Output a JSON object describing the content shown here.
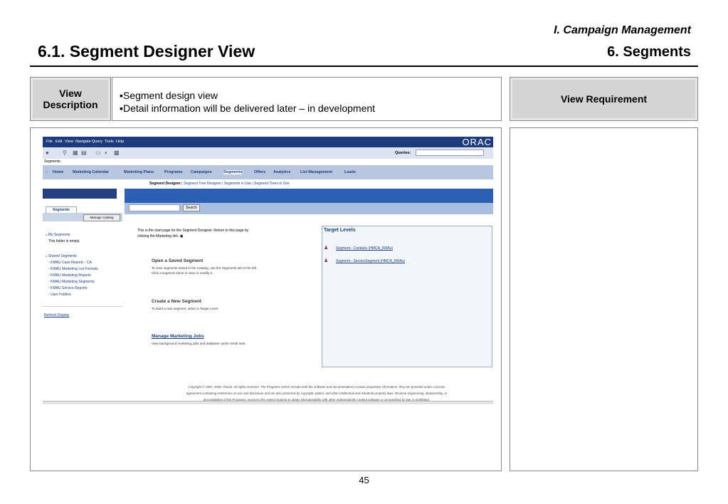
{
  "header": {
    "kicker": "I. Campaign Management",
    "title": "6.1. Segment Designer View",
    "section": "6. Segments"
  },
  "view_description": {
    "label_line1": "View",
    "label_line2": "Description",
    "bullets": [
      "Segment design view",
      "Detail information will be delivered later – in development"
    ]
  },
  "view_requirement": {
    "label": "View Requirement"
  },
  "page_number": "45",
  "screenshot": {
    "menu": [
      "File",
      "Edit",
      "View",
      "Navigate",
      "Query",
      "Tools",
      "Help"
    ],
    "brand": "ORAC",
    "queries_label": "Queries:",
    "crumb": "Segments:",
    "tabs": [
      "Home",
      "Marketing Calendar",
      "Marketing Plans",
      "Programs",
      "Campaigns",
      "Segments",
      "Offers",
      "Analytics",
      "List Management",
      "Leads"
    ],
    "subtabs": {
      "active": "Segment Designer",
      "others": [
        "Segment Tree Designer",
        "Segments in Use",
        "Segment Trees in Use"
      ]
    },
    "left_nav": {
      "tab": "Segments",
      "manage_catalog": "Manage Catalog",
      "my_segments": "My Segments",
      "empty_note": "This folder is empty.",
      "shared_segments": "Shared Segments",
      "shared_items": [
        "KMAU Case Reports - CA",
        "KMAU Marketing List Formats",
        "KMAU Marketing Reports",
        "KMAU Marketing Segments",
        "KMAU Service Reports",
        "User Folders"
      ],
      "refresh": "Refresh Display"
    },
    "search_button": "Search",
    "intro_line1": "This is the start page for the Segment Designer. Return to this page by",
    "intro_line2": "clicking the Marketing link.",
    "open_heading": "Open a Saved Segment",
    "open_desc_1": "To view segments saved in the Catalog, use the Segments tab to the left.",
    "open_desc_2": "Click a segment name to view or modify it.",
    "create_heading": "Create a New Segment",
    "create_desc": "To build a new segment, select a Target Level.",
    "jobs_heading": "Manage Marketing Jobs",
    "jobs_desc": "View background marketing jobs and database cache result sets.",
    "target_levels_title": "Target Levels",
    "target_levels": [
      "Segment - Contacts (HMCA_KMAu)",
      "Segment - ServiceSegment (HMCA_KMAu)"
    ],
    "copyright_1": "Copyright © 1997, 2009, Oracle. All rights reserved. The Programs (which include both the software and documentation) contain proprietary information; they are provided under a license",
    "copyright_2": "agreement containing restrictions on use and disclosure and are also protected by copyright, patent, and other intellectual and industrial property laws. Reverse engineering, disassembly, or",
    "copyright_3": "decompilation of the Programs, except to the extent required to obtain interoperability with other independently created software or as specified by law, is prohibited."
  }
}
